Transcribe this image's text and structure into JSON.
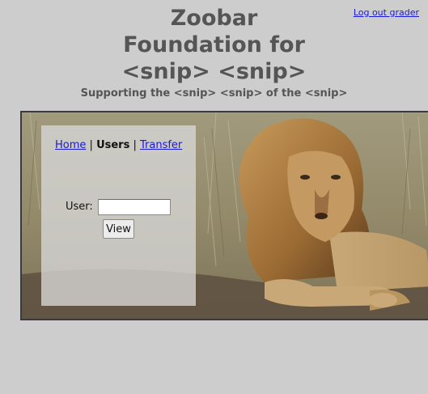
{
  "header": {
    "logout_label": "Log out grader",
    "title_lines": [
      "Zoobar",
      "Foundation for",
      "<snip> <snip>"
    ],
    "tagline": "Supporting the <snip> <snip> of the <snip>"
  },
  "nav": {
    "home_label": "Home",
    "separator": "|",
    "users_label": "Users",
    "transfer_label": "Transfer",
    "current": "Users"
  },
  "user_form": {
    "label": "User:",
    "input_value": "",
    "view_button_label": "View"
  },
  "banner": {
    "image_subject": "lion-photo"
  }
}
